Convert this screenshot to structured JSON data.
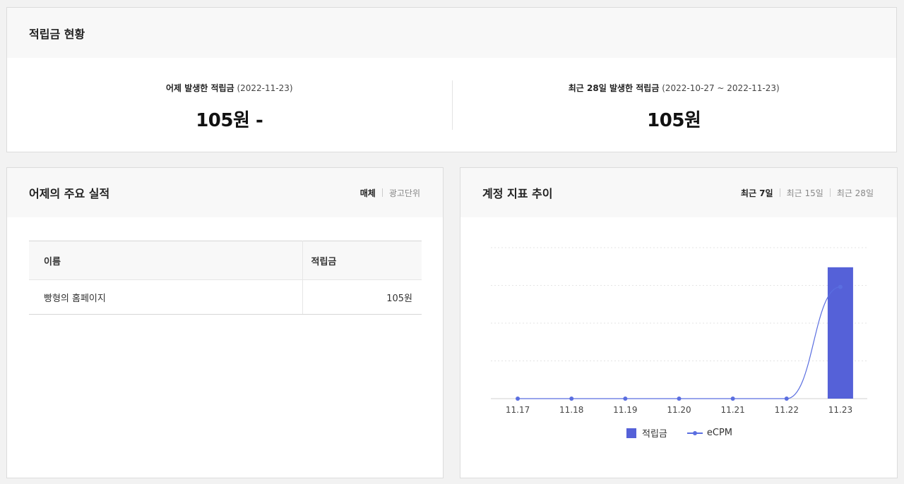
{
  "summary": {
    "title": "적립금 현황",
    "yesterday": {
      "label": "어제 발생한 적립금",
      "range": "(2022-11-23)",
      "value": "105원 -"
    },
    "recent": {
      "label": "최근 28일 발생한 적립금",
      "range": "(2022-10-27 ~ 2022-11-23)",
      "value": "105원"
    }
  },
  "performance": {
    "title": "어제의 주요 실적",
    "toggle": [
      "매체",
      "광고단위"
    ],
    "columns": [
      "이름",
      "적립금"
    ],
    "rows": [
      {
        "name": "빵형의 홈페이지",
        "amount": "105원"
      }
    ]
  },
  "trend": {
    "title": "계정 지표 추이",
    "periods": [
      "최근 7일",
      "최근 15일",
      "최근 28일"
    ]
  },
  "chart_data": {
    "type": "bar",
    "categories": [
      "11.17",
      "11.18",
      "11.19",
      "11.20",
      "11.21",
      "11.22",
      "11.23"
    ],
    "series": [
      {
        "name": "적립금",
        "type": "bar",
        "color": "#5561d8",
        "values": [
          0,
          0,
          0,
          0,
          0,
          0,
          105
        ]
      },
      {
        "name": "eCPM",
        "type": "line",
        "color": "#5a6ee0",
        "values": [
          0,
          0,
          0,
          0,
          0,
          0,
          0.8
        ]
      }
    ],
    "grid": true,
    "legend": "bottom"
  }
}
